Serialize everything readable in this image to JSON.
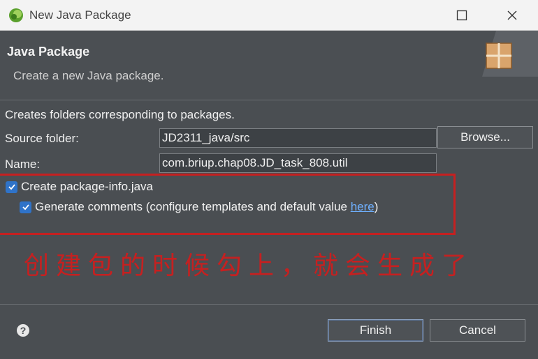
{
  "window": {
    "title": "New Java Package",
    "icons": {
      "app": "eclipse-icon",
      "maximize": "maximize-icon",
      "close": "close-icon"
    }
  },
  "banner": {
    "heading": "Java Package",
    "description": "Create a new Java package.",
    "icon": "package-wizard-icon"
  },
  "form": {
    "intro": "Creates folders corresponding to packages.",
    "source_folder_label": "Source folder:",
    "source_folder_value": "JD2311_java/src",
    "browse_label": "Browse...",
    "name_label": "Name:",
    "name_value": "com.briup.chap08.JD_task_808.util"
  },
  "options": {
    "create_info": {
      "label": "Create package-info.java",
      "checked": true
    },
    "generate_comments": {
      "label": "Generate comments (configure templates and default value ",
      "link": "here",
      "suffix": ")",
      "checked": true
    }
  },
  "annotation": {
    "text": "创建包的时候勾上，就会生成了",
    "color": "#c62020"
  },
  "footer": {
    "help_icon": "help-icon",
    "finish_label": "Finish",
    "cancel_label": "Cancel"
  },
  "colors": {
    "background": "#4a4e52",
    "accent": "#2f73c9",
    "link": "#6fb0ff",
    "annotation": "#c62020"
  }
}
